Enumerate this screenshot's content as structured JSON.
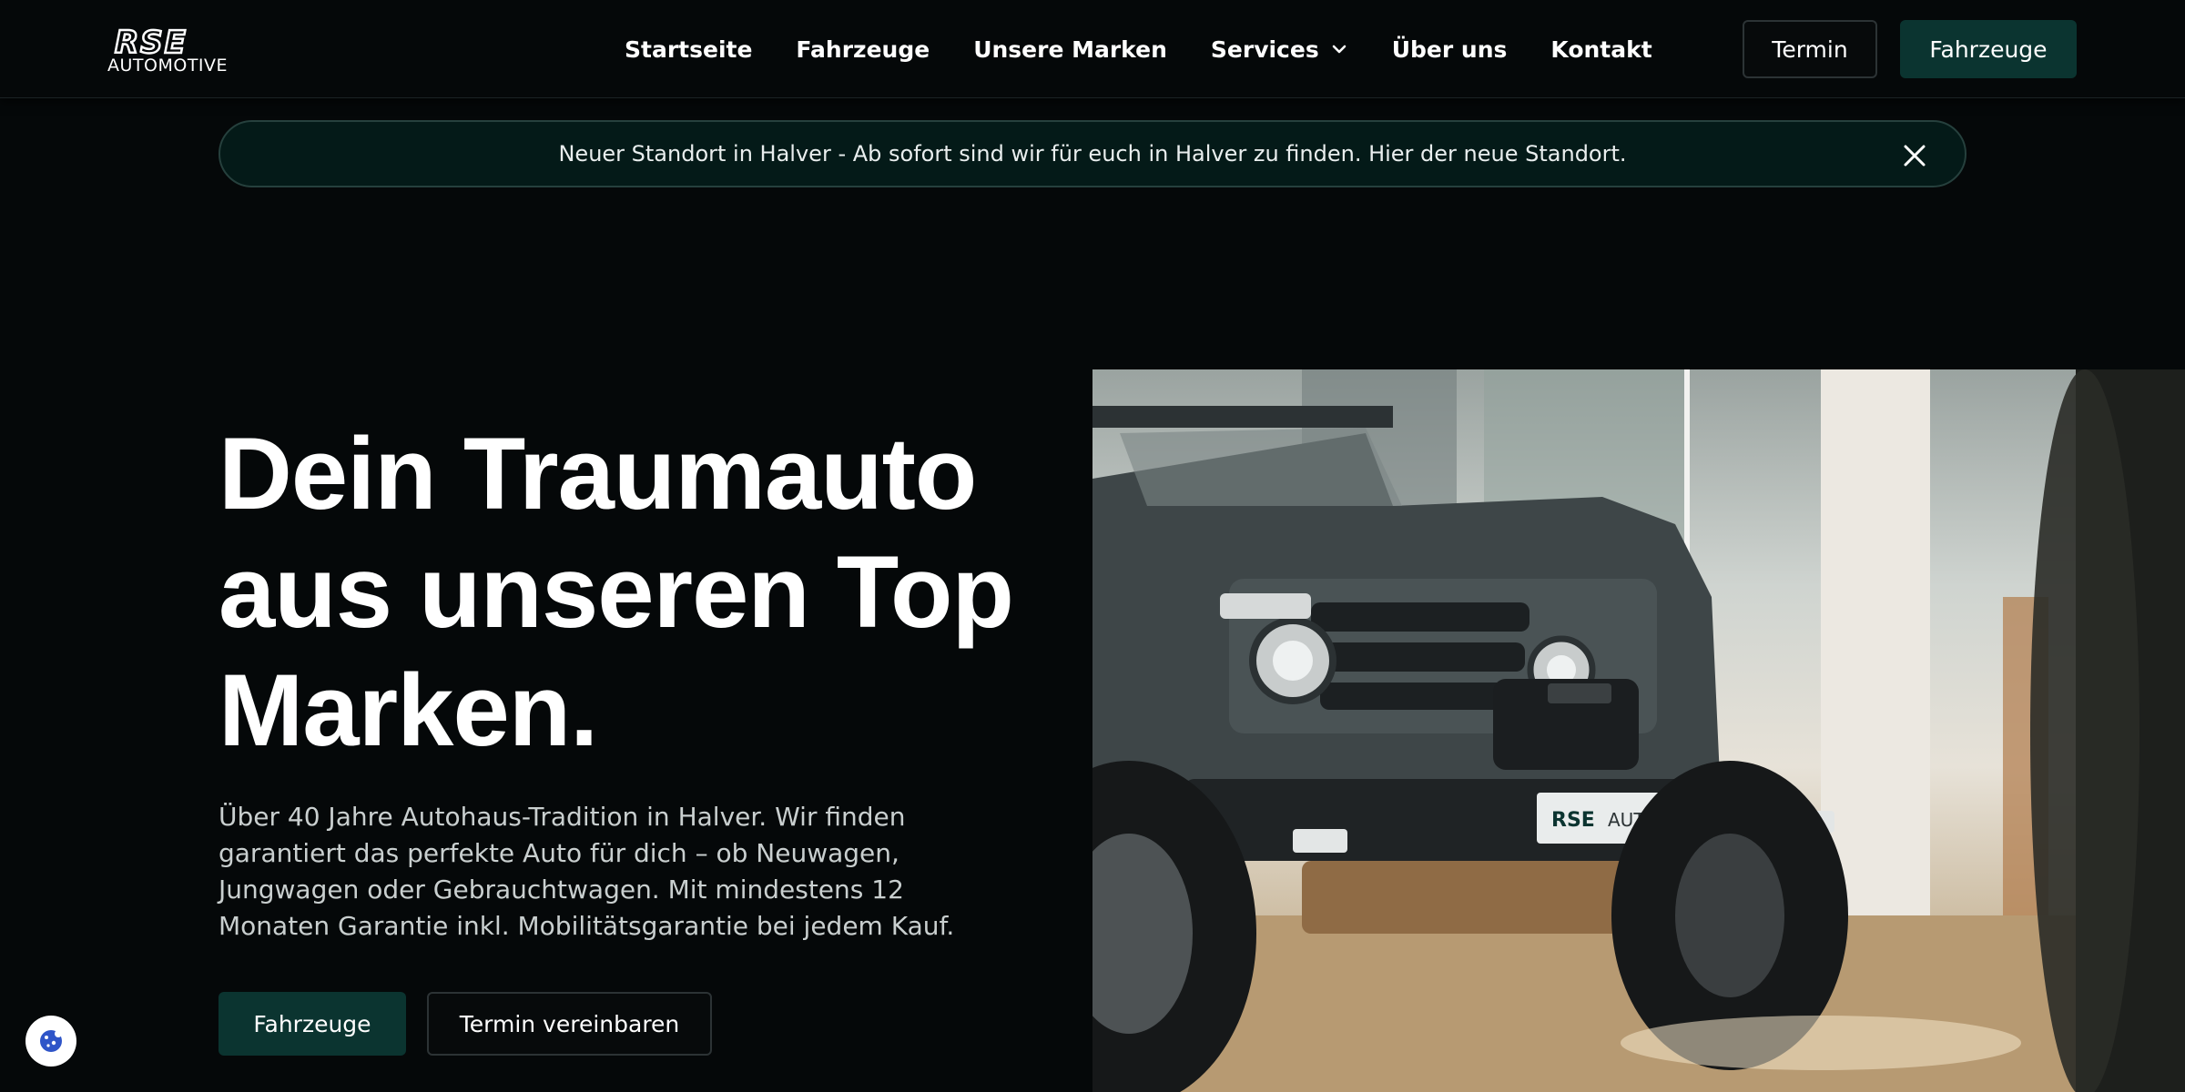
{
  "header": {
    "logo": {
      "top": "RSE",
      "bottom": "AUTOMOTIVE"
    },
    "nav": [
      {
        "label": "Startseite"
      },
      {
        "label": "Fahrzeuge"
      },
      {
        "label": "Unsere Marken"
      },
      {
        "label": "Services",
        "icon": "chevron-down-icon"
      },
      {
        "label": "Über uns"
      },
      {
        "label": "Kontakt"
      }
    ],
    "termin_button": "Termin",
    "fahrzeuge_button": "Fahrzeuge"
  },
  "announcement": {
    "text": "Neuer Standort in Halver - Ab sofort sind wir für euch in Halver zu finden. Hier der neue Standort.",
    "close_icon": "close-icon"
  },
  "hero": {
    "title_line1": "Dein Traumauto",
    "title_line2": "aus unseren Top",
    "title_line3": "Marken.",
    "text": "Über 40 Jahre Autohaus-Tradition in Halver. Wir finden garantiert das perfekte Auto für dich – ob Neuwagen, Jungwagen oder Gebrauchtwagen. Mit mindestens 12 Monaten Garantie inkl. Mobilitätsgarantie bei jedem Kauf.",
    "primary_button": "Fahrzeuge",
    "secondary_button": "Termin vereinbaren",
    "image": {
      "plate_brand": "RSE",
      "plate_text": "AUTOMOTIVE"
    }
  },
  "cookie": {
    "icon": "cookie-icon"
  },
  "colors": {
    "background": "#050809",
    "accent": "#0b3430",
    "banner": "#041a18"
  }
}
